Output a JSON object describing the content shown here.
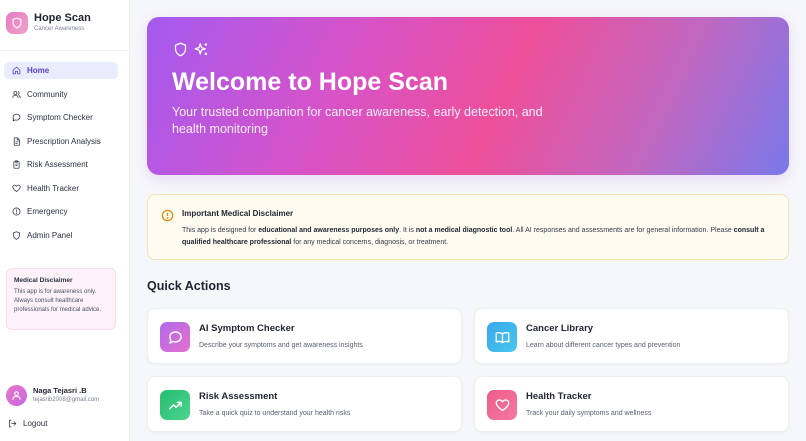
{
  "brand": {
    "title": "Hope Scan",
    "subtitle": "Cancer Awareness"
  },
  "nav": [
    {
      "label": "Home",
      "icon": "home-icon",
      "active": true
    },
    {
      "label": "Community",
      "icon": "users-icon"
    },
    {
      "label": "Symptom Checker",
      "icon": "chat-icon"
    },
    {
      "label": "Prescription Analysis",
      "icon": "file-icon"
    },
    {
      "label": "Risk Assessment",
      "icon": "clipboard-icon"
    },
    {
      "label": "Health Tracker",
      "icon": "heart-icon"
    },
    {
      "label": "Emergency",
      "icon": "alert-circle-icon"
    },
    {
      "label": "Admin Panel",
      "icon": "shield-icon"
    }
  ],
  "sidebar_disclaimer": {
    "title": "Medical Disclaimer",
    "text": "This app is for awareness only. Always consult healthcare professionals for medical advice."
  },
  "user": {
    "name": "Naga Tejasri .B",
    "email": "tejasrib2008@gmail.com"
  },
  "logout_label": "Logout",
  "hero": {
    "title": "Welcome to Hope Scan",
    "subtitle": "Your trusted companion for cancer awareness, early detection, and health monitoring"
  },
  "disclaimer": {
    "title": "Important Medical Disclaimer",
    "p1": "This app is designed for ",
    "b1": "educational and awareness purposes only",
    "p2": ". It is ",
    "b2": "not a medical diagnostic tool",
    "p3": ". All AI responses and assessments are for general information. Please ",
    "b3": "consult a qualified healthcare professional",
    "p4": " for any medical concerns, diagnosis, or treatment."
  },
  "quick_actions": {
    "title": "Quick Actions",
    "cards": [
      {
        "title": "AI Symptom Checker",
        "desc": "Describe your symptoms and get awareness insights",
        "icon": "chat-bubble-icon",
        "color": "#c46ae0"
      },
      {
        "title": "Cancer Library",
        "desc": "Learn about different cancer types and prevention",
        "icon": "book-icon",
        "color": "#3fb2ea"
      },
      {
        "title": "Risk Assessment",
        "desc": "Take a quick quiz to understand your health risks",
        "icon": "trending-up-icon",
        "color": "#2fc47a"
      },
      {
        "title": "Health Tracker",
        "desc": "Track your daily symptoms and wellness",
        "icon": "heart-icon",
        "color": "#f0668f"
      }
    ]
  },
  "colors": {
    "accent": "#5b3fd8",
    "active_nav_bg": "#e9ecfd",
    "disclaimer_bg": "#fefbf1"
  }
}
